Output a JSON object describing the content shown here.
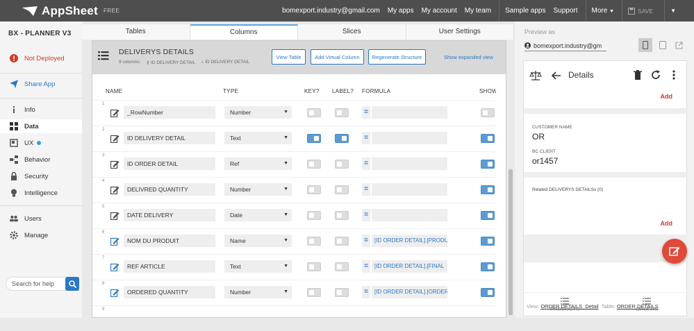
{
  "app": {
    "brand": "AppSheet",
    "plan": "FREE"
  },
  "topnav": {
    "email": "bomexport.industry@gmail.com",
    "my_apps": "My apps",
    "my_account": "My account",
    "my_team": "My team",
    "sample_apps": "Sample apps",
    "support": "Support",
    "more": "More",
    "save": "SAVE"
  },
  "sidebar": {
    "title": "BX - PLANNER V3",
    "status": "Not Deployed",
    "share": "Share App",
    "items": [
      {
        "label": "Info",
        "icon": "info-icon"
      },
      {
        "label": "Data",
        "icon": "grid-icon",
        "active": true
      },
      {
        "label": "UX",
        "icon": "ux-icon"
      },
      {
        "label": "Behavior",
        "icon": "behavior-icon"
      },
      {
        "label": "Security",
        "icon": "lock-icon"
      },
      {
        "label": "Intelligence",
        "icon": "bulb-icon"
      },
      {
        "label": "Users",
        "icon": "users-icon"
      },
      {
        "label": "Manage",
        "icon": "gear-icon"
      }
    ],
    "search_placeholder": "Search for help"
  },
  "tabs": [
    "Tables",
    "Columns",
    "Slices",
    "User Settings"
  ],
  "table": {
    "name": "DELIVERYS DETAILS",
    "count": "9 columns:",
    "key_col": "ID DELIVERY DETAIL",
    "label_col": "ID DELIVERY DETAIL",
    "btn_view": "View Table",
    "btn_virtual": "Add Virtual Column",
    "btn_regen": "Regenerate Structure",
    "link_expanded": "Show expanded view",
    "headers": {
      "name": "NAME",
      "type": "TYPE",
      "key": "KEY?",
      "label": "LABEL?",
      "formula": "FORMULA",
      "show": "SHOW"
    },
    "rows": [
      {
        "n": "1",
        "name": "_RowNumber",
        "type": "Number",
        "key": false,
        "label": false,
        "formula": "",
        "show": false
      },
      {
        "n": "2",
        "name": "ID DELIVERY DETAIL",
        "type": "Text",
        "key": true,
        "label": true,
        "formula": "",
        "show": true
      },
      {
        "n": "3",
        "name": "ID ORDER DETAIL",
        "type": "Ref",
        "key": false,
        "label": false,
        "formula": "",
        "show": true
      },
      {
        "n": "4",
        "name": "DELIVRED QUANTITY",
        "type": "Number",
        "key": false,
        "label": false,
        "formula": "",
        "show": true
      },
      {
        "n": "5",
        "name": "DATE DELIVERY",
        "type": "Date",
        "key": false,
        "label": false,
        "formula": "",
        "show": true
      },
      {
        "n": "6",
        "name": "NOM DU PRODUIT",
        "type": "Name",
        "key": false,
        "label": false,
        "formula": "[ID ORDER DETAIL].[PRODU",
        "show": true
      },
      {
        "n": "7",
        "name": "REF ARTICLE",
        "type": "Text",
        "key": false,
        "label": false,
        "formula": "[ID ORDER DETAIL].[FINAL",
        "show": true
      },
      {
        "n": "8",
        "name": "ORDERED QUANTITY",
        "type": "Number",
        "key": false,
        "label": false,
        "formula": "[ID ORDER DETAIL].[ORDER",
        "show": true
      },
      {
        "n": "9",
        "name": "",
        "type": "",
        "key": false,
        "label": false,
        "formula": "",
        "show": false
      }
    ]
  },
  "preview": {
    "label": "Preview as",
    "account": "bomexport.industry@gm",
    "screen_title": "Details",
    "add1": "Add",
    "customer_label": "CUSTOMER NAME",
    "customer_value": "OR",
    "bc_label": "BC CLIENT",
    "bc_value": "or1457",
    "related": "Related DELIVERYS DETAILSs (0)",
    "add2": "Add",
    "nav_products": "PRODUCTS",
    "nav_orders": "ORDERS",
    "view_label": "View:",
    "view_name": "ORDER DETAILS_Detail",
    "table_label": "Table:",
    "table_name": "ORDER DETAILS"
  },
  "colors": {
    "accent": "#2a78c6",
    "toggle_on": "#5b9bd5",
    "danger": "#d03a2c",
    "topbar": "#4e4e4e"
  }
}
